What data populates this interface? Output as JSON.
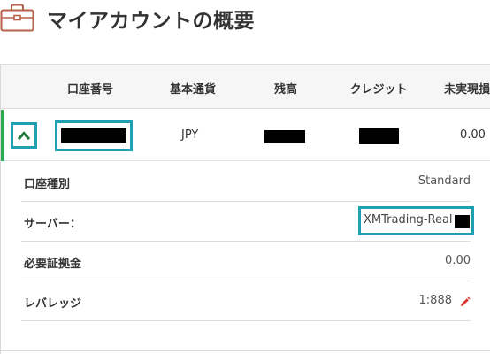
{
  "page": {
    "title": "マイアカウントの概要"
  },
  "icons": {
    "header": "briefcase-icon",
    "toggle": "chevron-up-icon",
    "edit": "pencil-icon"
  },
  "colors": {
    "highlight": "#1ea0b4",
    "accent": "#2eaa4e",
    "chevron": "#1f7a3e",
    "edit": "#d9342b"
  },
  "table": {
    "columns": [
      "口座番号",
      "基本通貨",
      "残高",
      "クレジット",
      "未実現損"
    ],
    "row": {
      "account_number": "",
      "currency": "JPY",
      "balance": "",
      "credit": "",
      "unrealized": "0.00"
    }
  },
  "details": {
    "account_type": {
      "label": "口座種別",
      "value": "Standard"
    },
    "server": {
      "label": "サーバー：",
      "value": "XMTrading-Real"
    },
    "margin": {
      "label": "必要証拠金",
      "value": "0.00"
    },
    "leverage": {
      "label": "レバレッジ",
      "value": "1:888"
    }
  }
}
